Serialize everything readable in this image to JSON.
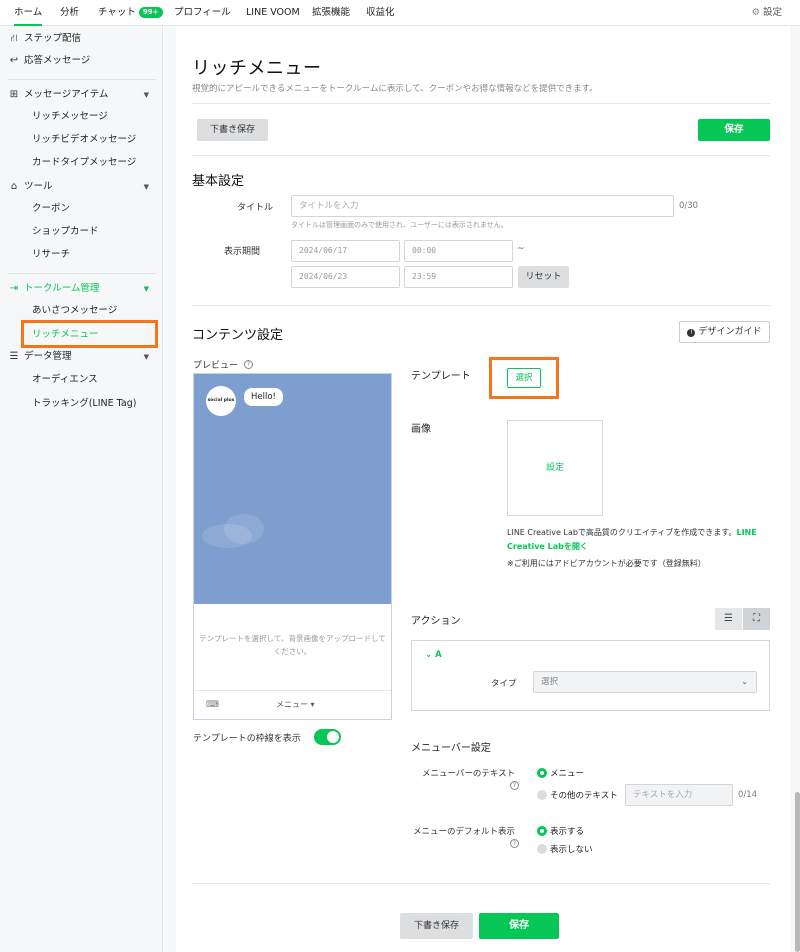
{
  "colors": {
    "accent": "#06c755",
    "highlight": "#f5761a",
    "preview_bg": "#7d9ecf"
  },
  "topnav": {
    "tabs": [
      "ホーム",
      "分析",
      "チャット",
      "プロフィール",
      "LINE VOOM",
      "拡張機能",
      "収益化"
    ],
    "chat_badge": "99+",
    "settings_label": "設定",
    "settings_icon": "gear-icon"
  },
  "sidebar": {
    "step": "ステップ配信",
    "auto_reply": "応答メッセージ",
    "message_items": "メッセージアイテム",
    "rich_message": "リッチメッセージ",
    "rich_video": "リッチビデオメッセージ",
    "card_type": "カードタイプメッセージ",
    "tools": "ツール",
    "coupon": "クーポン",
    "shop_card": "ショップカード",
    "research": "リサーチ",
    "talkroom": "トークルーム管理",
    "greeting": "あいさつメッセージ",
    "rich_menu": "リッチメニュー",
    "data_mgmt": "データ管理",
    "audience": "オーディエンス",
    "tracking": "トラッキング(LINE Tag)"
  },
  "page": {
    "title": "リッチメニュー",
    "description": "視覚的にアピールできるメニューをトークルームに表示して、クーポンやお得な情報などを提供できます。",
    "draft_save": "下書き保存",
    "save": "保存"
  },
  "basic": {
    "heading": "基本設定",
    "title_label": "タイトル",
    "title_placeholder": "タイトルを入力",
    "title_counter": "0/30",
    "title_note": "タイトルは管理画面のみで使用され、ユーザーには表示されません。",
    "period_label": "表示期間",
    "start_date": "2024/06/17",
    "start_time": "00:00",
    "tilde": "~",
    "end_date": "2024/06/23",
    "end_time": "23:59",
    "reset": "リセット"
  },
  "content": {
    "heading": "コンテンツ設定",
    "design_guide": "デザインガイド",
    "preview_label": "プレビュー",
    "avatar_text": "social plus",
    "bubble_text": "Hello!",
    "preview_hint": "テンプレートを選択して、背景画像をアップロードしてください。",
    "menu_label": "メニュー ▾",
    "frame_toggle_label": "テンプレートの枠線を表示",
    "frame_toggle_on": true,
    "template_label": "テンプレート",
    "template_select": "選択",
    "image_label": "画像",
    "image_set": "設定",
    "creative_text_1": "LINE Creative Labで高品質のクリエイティブを作成できます。",
    "creative_link_1": "LINE",
    "creative_link_2": "Creative Labを開く",
    "adobe_note": "※ご利用にはアドビアカウントが必要です（登録無料）",
    "action_label": "アクション",
    "action_area": "A",
    "type_label": "タイプ",
    "type_select": "選択"
  },
  "menubar": {
    "heading": "メニューバー設定",
    "text_label": "メニューバーのテキスト",
    "opt_menu": "メニュー",
    "opt_other": "その他のテキスト",
    "text_placeholder": "テキストを入力",
    "text_counter": "0/14",
    "default_label": "メニューのデフォルト表示",
    "opt_show": "表示する",
    "opt_hide": "表示しない"
  }
}
